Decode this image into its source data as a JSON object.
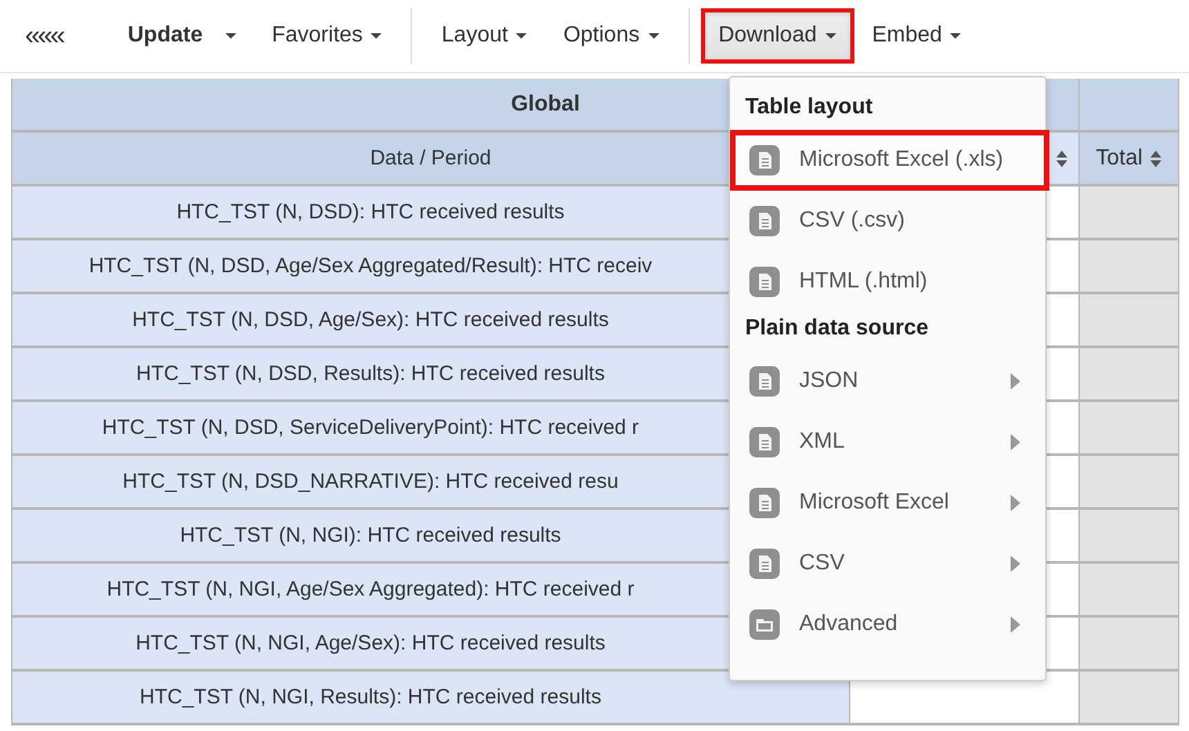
{
  "toolbar": [
    {
      "kind": "collapse",
      "label": "«««"
    },
    {
      "kind": "split",
      "label": "Update",
      "bold": true,
      "pressed": false,
      "highlighted": false
    },
    {
      "kind": "dropdown",
      "label": "Favorites",
      "bold": false,
      "pressed": false,
      "highlighted": false
    },
    {
      "kind": "separator"
    },
    {
      "kind": "dropdown",
      "label": "Layout",
      "bold": false,
      "pressed": false,
      "highlighted": false
    },
    {
      "kind": "dropdown",
      "label": "Options",
      "bold": false,
      "pressed": false,
      "highlighted": false
    },
    {
      "kind": "separator"
    },
    {
      "kind": "dropdown",
      "label": "Download",
      "bold": false,
      "pressed": true,
      "highlighted": true
    },
    {
      "kind": "dropdown",
      "label": "Embed",
      "bold": false,
      "pressed": false,
      "highlighted": false
    }
  ],
  "table": {
    "title": "Global",
    "columns": [
      {
        "label": "Data / Period",
        "sortable": false
      },
      {
        "sortable": true
      },
      {
        "label": "Total",
        "sortable": true
      }
    ],
    "rows": [
      "HTC_TST (N, DSD): HTC received results",
      "HTC_TST (N, DSD, Age/Sex Aggregated/Result): HTC receiv",
      "HTC_TST (N, DSD, Age/Sex): HTC received results",
      "HTC_TST (N, DSD, Results): HTC received results",
      "HTC_TST (N, DSD, ServiceDeliveryPoint): HTC received r",
      "HTC_TST (N, DSD_NARRATIVE): HTC received resu",
      "HTC_TST (N, NGI): HTC received results",
      "HTC_TST (N, NGI, Age/Sex Aggregated): HTC received r",
      "HTC_TST (N, NGI, Age/Sex): HTC received results",
      "HTC_TST (N, NGI, Results): HTC received results"
    ]
  },
  "download_menu": [
    {
      "kind": "header",
      "label": "Table layout"
    },
    {
      "kind": "file",
      "label": "Microsoft Excel (.xls)",
      "submenu": false,
      "highlighted": true
    },
    {
      "kind": "file",
      "label": "CSV (.csv)",
      "submenu": false,
      "highlighted": false
    },
    {
      "kind": "file",
      "label": "HTML (.html)",
      "submenu": false,
      "highlighted": false
    },
    {
      "kind": "header",
      "label": "Plain data source"
    },
    {
      "kind": "file",
      "label": "JSON",
      "submenu": true,
      "highlighted": false
    },
    {
      "kind": "file",
      "label": "XML",
      "submenu": true,
      "highlighted": false
    },
    {
      "kind": "file",
      "label": "Microsoft Excel",
      "submenu": true,
      "highlighted": false
    },
    {
      "kind": "file",
      "label": "CSV",
      "submenu": true,
      "highlighted": false
    },
    {
      "kind": "folder",
      "label": "Advanced",
      "submenu": true,
      "highlighted": false
    }
  ]
}
